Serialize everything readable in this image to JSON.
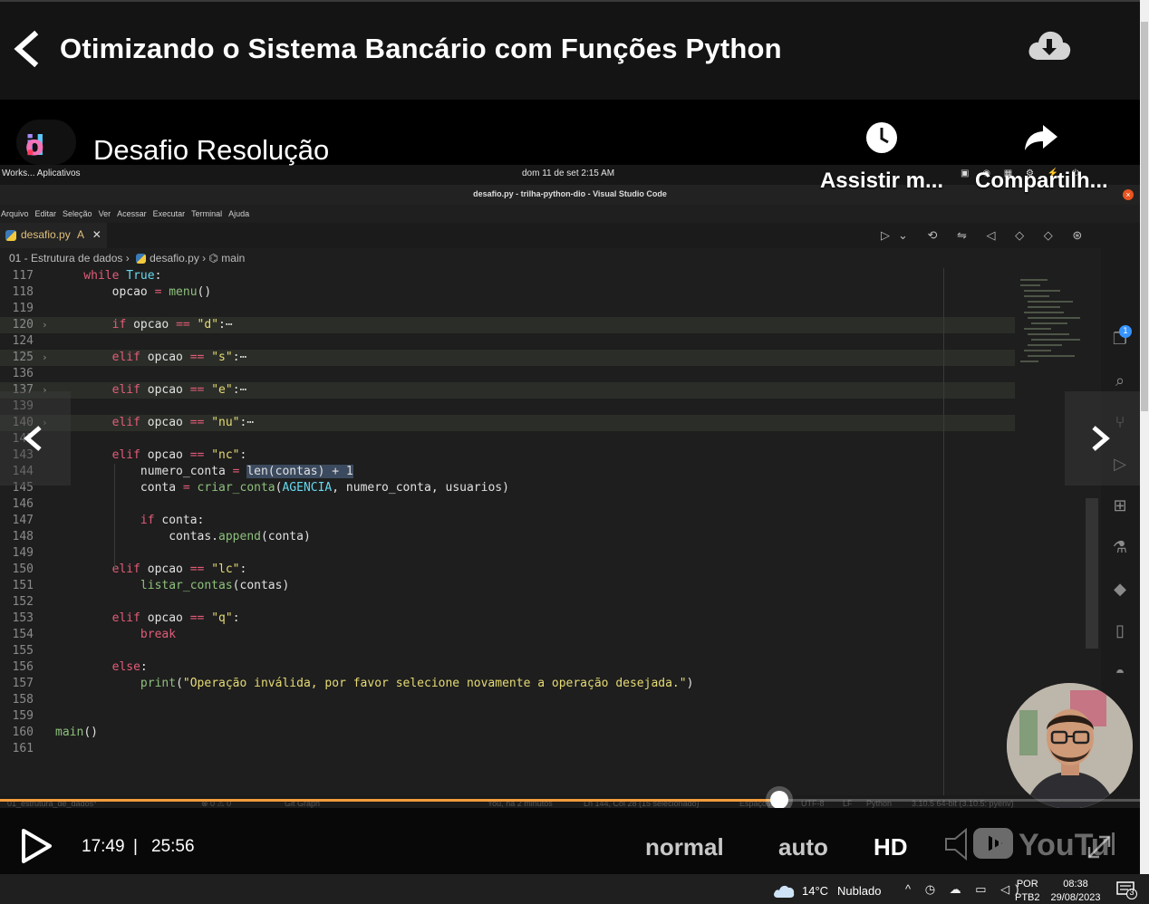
{
  "header": {
    "title": "Otimizando o Sistema Bancário com Funções Python"
  },
  "video": {
    "title": "Desafio Resolução",
    "channel_logo_text": "dio.",
    "watch_later_label": "Assistir m...",
    "share_label": "Compartilh...",
    "gnome_bar": {
      "left": "Works... Aplicativos",
      "center": "dom 11 de set  2:15 AM"
    },
    "vscode": {
      "window_title": "desafio.py - trilha-python-dio - Visual Studio Code",
      "menu": [
        "Arquivo",
        "Editar",
        "Seleção",
        "Ver",
        "Acessar",
        "Executar",
        "Terminal",
        "Ajuda"
      ],
      "tab_label": "desafio.py",
      "tab_status": "A",
      "breadcrumb": [
        "01 - Estrutura de dados",
        "desafio.py",
        "main"
      ],
      "lines": [
        {
          "n": "117",
          "fold": false,
          "foldIcon": "",
          "code": [
            [
              "kw",
              "    while "
            ],
            [
              "cn",
              "True"
            ],
            [
              "",
              ":"
            ]
          ]
        },
        {
          "n": "118",
          "fold": false,
          "foldIcon": "",
          "code": [
            [
              "",
              "        opcao "
            ],
            [
              "op",
              "="
            ],
            [
              "fn",
              " menu"
            ],
            [
              "",
              "()"
            ]
          ]
        },
        {
          "n": "119",
          "fold": false,
          "foldIcon": "",
          "code": []
        },
        {
          "n": "120",
          "fold": true,
          "foldIcon": "›",
          "code": [
            [
              "kw",
              "        if"
            ],
            [
              "",
              " opcao "
            ],
            [
              "op",
              "=="
            ],
            [
              "str",
              " \"d\""
            ],
            [
              "",
              ":⋯"
            ]
          ]
        },
        {
          "n": "124",
          "fold": false,
          "foldIcon": "",
          "code": []
        },
        {
          "n": "125",
          "fold": true,
          "foldIcon": "›",
          "code": [
            [
              "kw",
              "        elif"
            ],
            [
              "",
              " opcao "
            ],
            [
              "op",
              "=="
            ],
            [
              "str",
              " \"s\""
            ],
            [
              "",
              ":⋯"
            ]
          ]
        },
        {
          "n": "136",
          "fold": false,
          "foldIcon": "",
          "code": []
        },
        {
          "n": "137",
          "fold": true,
          "foldIcon": "›",
          "code": [
            [
              "kw",
              "        elif"
            ],
            [
              "",
              " opcao "
            ],
            [
              "op",
              "=="
            ],
            [
              "str",
              " \"e\""
            ],
            [
              "",
              ":⋯"
            ]
          ]
        },
        {
          "n": "139",
          "fold": false,
          "foldIcon": "",
          "code": []
        },
        {
          "n": "140",
          "fold": true,
          "foldIcon": "›",
          "code": [
            [
              "kw",
              "        elif"
            ],
            [
              "",
              " opcao "
            ],
            [
              "op",
              "=="
            ],
            [
              "str",
              " \"nu\""
            ],
            [
              "",
              ":⋯"
            ]
          ]
        },
        {
          "n": "142",
          "fold": false,
          "foldIcon": "",
          "code": []
        },
        {
          "n": "143",
          "fold": false,
          "foldIcon": "",
          "code": [
            [
              "kw",
              "        elif"
            ],
            [
              "",
              " opcao "
            ],
            [
              "op",
              "=="
            ],
            [
              "str",
              " \"nc\""
            ],
            [
              "",
              ":"
            ]
          ]
        },
        {
          "n": "144",
          "fold": false,
          "foldIcon": "",
          "code": [
            [
              "",
              "            numero_conta "
            ],
            [
              "op",
              "="
            ],
            [
              "",
              " "
            ],
            [
              "sel",
              "len(contas) + 1"
            ]
          ]
        },
        {
          "n": "145",
          "fold": false,
          "foldIcon": "",
          "code": [
            [
              "",
              "            conta "
            ],
            [
              "op",
              "="
            ],
            [
              "fn",
              " criar_conta"
            ],
            [
              "",
              "("
            ],
            [
              "cn",
              "AGENCIA"
            ],
            [
              "",
              ", numero_conta, usuarios)"
            ]
          ]
        },
        {
          "n": "146",
          "fold": false,
          "foldIcon": "",
          "code": []
        },
        {
          "n": "147",
          "fold": false,
          "foldIcon": "",
          "code": [
            [
              "kw",
              "            if"
            ],
            [
              "",
              " conta:"
            ]
          ]
        },
        {
          "n": "148",
          "fold": false,
          "foldIcon": "",
          "code": [
            [
              "",
              "                contas."
            ],
            [
              "fn",
              "append"
            ],
            [
              "",
              "(conta)"
            ]
          ]
        },
        {
          "n": "149",
          "fold": false,
          "foldIcon": "",
          "code": []
        },
        {
          "n": "150",
          "fold": false,
          "foldIcon": "",
          "code": [
            [
              "kw",
              "        elif"
            ],
            [
              "",
              " opcao "
            ],
            [
              "op",
              "=="
            ],
            [
              "str",
              " \"lc\""
            ],
            [
              "",
              ":"
            ]
          ]
        },
        {
          "n": "151",
          "fold": false,
          "foldIcon": "",
          "code": [
            [
              "fn",
              "            listar_contas"
            ],
            [
              "",
              "(contas)"
            ]
          ]
        },
        {
          "n": "152",
          "fold": false,
          "foldIcon": "",
          "code": []
        },
        {
          "n": "153",
          "fold": false,
          "foldIcon": "",
          "code": [
            [
              "kw",
              "        elif"
            ],
            [
              "",
              " opcao "
            ],
            [
              "op",
              "=="
            ],
            [
              "str",
              " \"q\""
            ],
            [
              "",
              ":"
            ]
          ]
        },
        {
          "n": "154",
          "fold": false,
          "foldIcon": "",
          "code": [
            [
              "kw",
              "            break"
            ]
          ]
        },
        {
          "n": "155",
          "fold": false,
          "foldIcon": "",
          "code": []
        },
        {
          "n": "156",
          "fold": false,
          "foldIcon": "",
          "code": [
            [
              "kw",
              "        else"
            ],
            [
              "",
              ":"
            ]
          ]
        },
        {
          "n": "157",
          "fold": false,
          "foldIcon": "",
          "code": [
            [
              "fn",
              "            print"
            ],
            [
              "",
              "("
            ],
            [
              "str",
              "\"Operação inválida, por favor selecione novamente a operação desejada.\""
            ],
            [
              "",
              ")"
            ]
          ]
        },
        {
          "n": "158",
          "fold": false,
          "foldIcon": "",
          "code": []
        },
        {
          "n": "159",
          "fold": false,
          "foldIcon": "",
          "code": []
        },
        {
          "n": "160",
          "fold": false,
          "foldIcon": "",
          "code": [
            [
              "fn",
              "main"
            ],
            [
              "",
              "()"
            ]
          ]
        },
        {
          "n": "161",
          "fold": false,
          "foldIcon": "",
          "code": []
        }
      ],
      "activity_badge": "1",
      "status_items": [
        "01_estrutura_de_dados*",
        "⊗ 0 ⚠ 0",
        "Git Graph",
        "You, há 2 minutos",
        "Ln 144, Col 28 (15 selecionado)",
        "Espaços: 4",
        "UTF-8",
        "LF",
        "Python",
        "3.10.5 64-bit (3.10.5: pyenv)"
      ]
    }
  },
  "player": {
    "current_time": "17:49",
    "separator": "|",
    "total_time": "25:56",
    "progress_percent": 68.4,
    "speed_label": "normal",
    "quality_auto_label": "auto",
    "hd_label": "HD"
  },
  "taskbar": {
    "temperature": "14°C",
    "condition": "Nublado",
    "lang_line1": "POR",
    "lang_line2": "PTB2",
    "time": "08:38",
    "date": "29/08/2023",
    "notification_count": "3"
  }
}
